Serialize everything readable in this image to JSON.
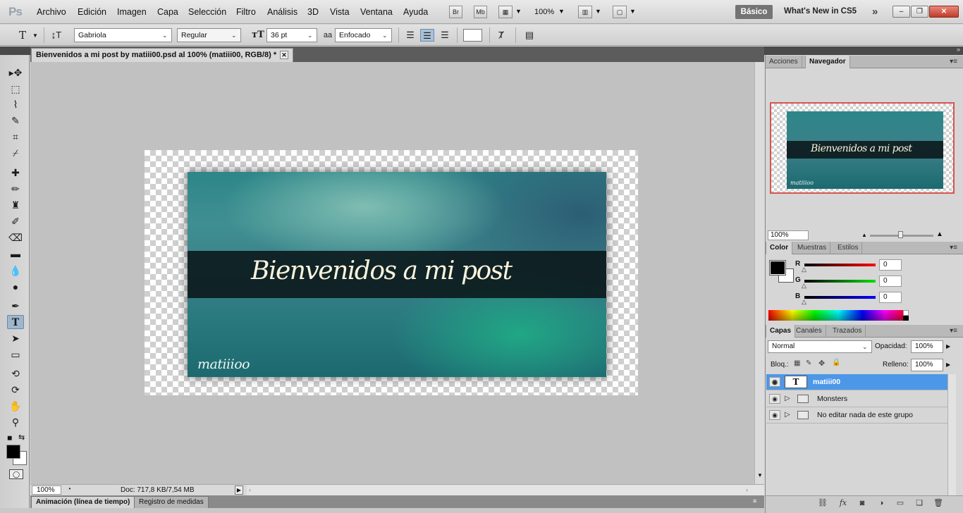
{
  "app": {
    "logo": "Ps"
  },
  "menu": [
    "Archivo",
    "Edición",
    "Imagen",
    "Capa",
    "Selección",
    "Filtro",
    "Análisis",
    "3D",
    "Vista",
    "Ventana",
    "Ayuda"
  ],
  "appbar": {
    "bridge": "Br",
    "minibridge": "Mb",
    "zoom": "100%",
    "workspace": "Básico",
    "whats_new": "What's New in CS5"
  },
  "options": {
    "font_family": "Gabriola",
    "font_style": "Regular",
    "font_size": "36 pt",
    "antialias_symbol": "a",
    "antialias": "Enfocado"
  },
  "document": {
    "tab_title": "Bienvenidos a mi post by matiii00.psd al 100% (matiii00, RGB/8) *",
    "banner_text": "Bienvenidos a mi post",
    "signature": "matiiioo"
  },
  "status": {
    "zoom": "100%",
    "doc_info": "Doc: 717,8 KB/7,54 MB"
  },
  "bottom_tabs": [
    "Animación (línea de tiempo)",
    "Registro de medidas"
  ],
  "navigator": {
    "tabs": [
      "Acciones",
      "Navegador"
    ],
    "zoom": "100%"
  },
  "color_panel": {
    "tabs": [
      "Color",
      "Muestras",
      "Estilos"
    ],
    "R": "0",
    "G": "0",
    "B": "0",
    "labels": [
      "R",
      "G",
      "B"
    ]
  },
  "layers_panel": {
    "tabs": [
      "Capas",
      "Canales",
      "Trazados"
    ],
    "blend_mode": "Normal",
    "opacity_label": "Opacidad:",
    "opacity": "100%",
    "lock_label": "Bloq.:",
    "fill_label": "Relleno:",
    "fill": "100%",
    "layers": [
      {
        "name": "matiii00",
        "type": "text",
        "thumb": "T"
      },
      {
        "name": "Monsters",
        "type": "group"
      },
      {
        "name": "No editar nada de este grupo",
        "type": "group"
      }
    ]
  },
  "colors": {
    "accent_selection": "#4d97e8",
    "navigator_frame": "#d9534f"
  }
}
